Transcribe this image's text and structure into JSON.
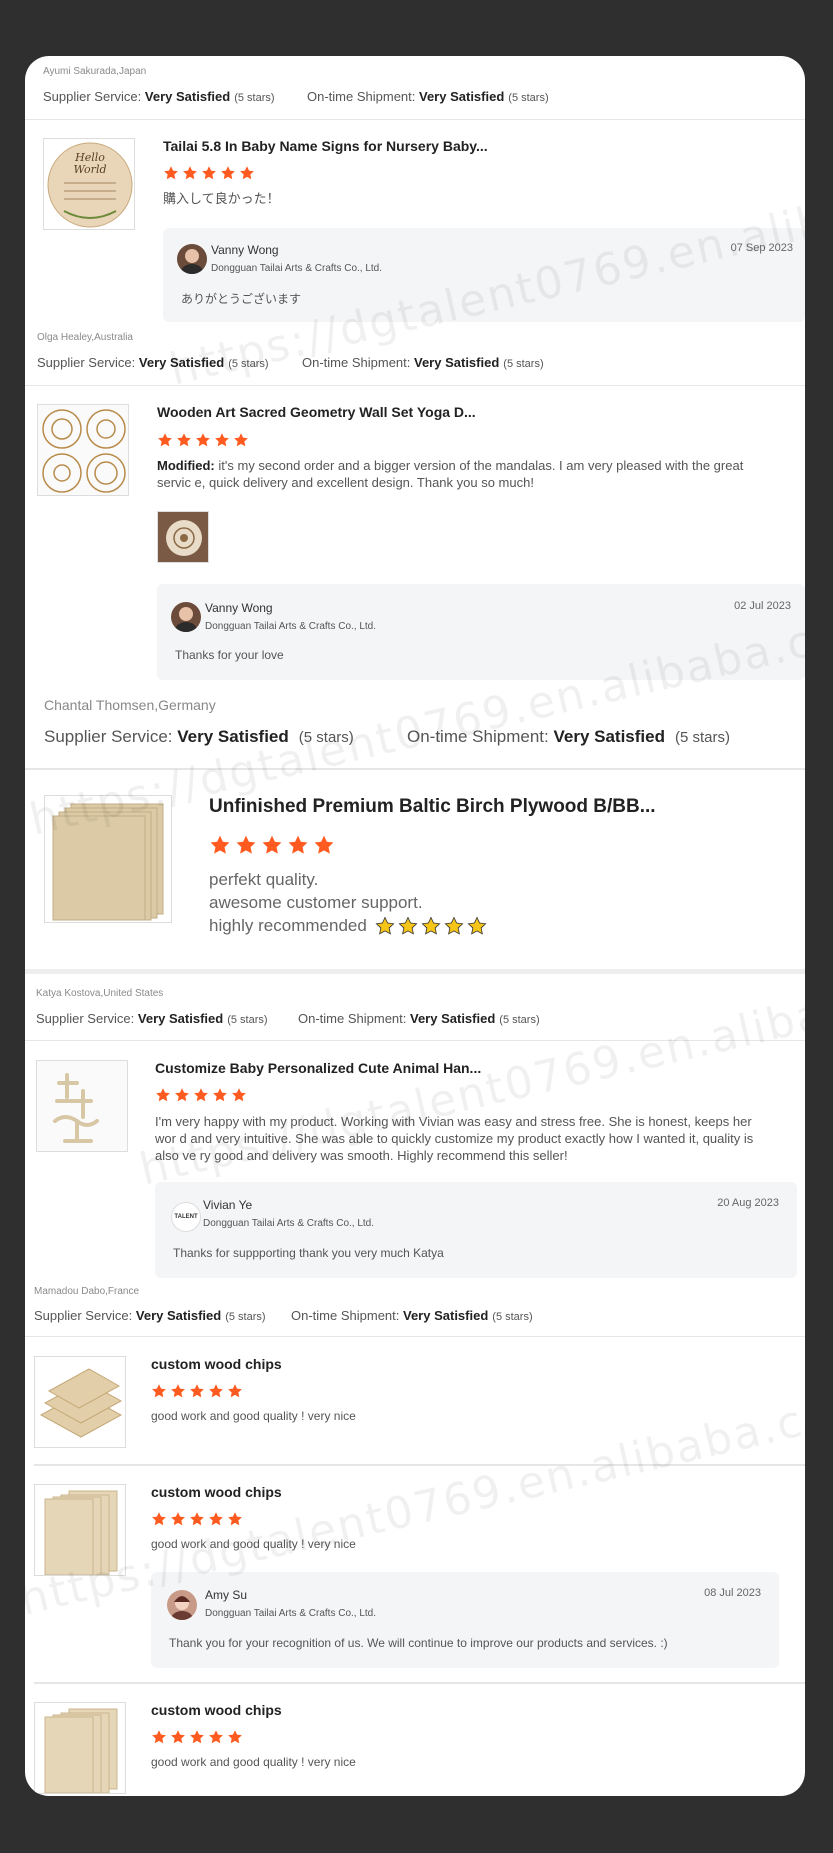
{
  "colors": {
    "star": "#ff5a1f",
    "reply_bg": "#f4f5f7",
    "gold_star": "#f5c518"
  },
  "watermark": "https://dgtalent0769.en.alibaba.com/",
  "reviews": [
    {
      "reviewer": "Ayumi Sakurada,Japan",
      "service_label": "Supplier Service:",
      "service_value": "Very Satisfied",
      "service_stars": "(5 stars)",
      "shipment_label": "On-time Shipment:",
      "shipment_value": "Very Satisfied",
      "shipment_stars": "(5 stars)",
      "product": "Tailai 5.8 In Baby Name Signs for Nursery Baby...",
      "text": "購入して良かった！",
      "reply": {
        "name": "Vanny Wong",
        "company": "Dongguan Tailai Arts & Crafts Co., Ltd.",
        "date": "07 Sep 2023",
        "text": "ありがとうございます"
      }
    },
    {
      "reviewer": "Olga Healey,Australia",
      "service_label": "Supplier Service:",
      "service_value": "Very Satisfied",
      "service_stars": "(5 stars)",
      "shipment_label": "On-time Shipment:",
      "shipment_value": "Very Satisfied",
      "shipment_stars": "(5 stars)",
      "product": "Wooden Art Sacred Geometry Wall Set Yoga D...",
      "text_prefix": "Modified:",
      "text": "it's my second order and a bigger version of the mandalas. I am very pleased with the great servic e, quick delivery and excellent design. Thank you so much!",
      "reply": {
        "name": "Vanny Wong",
        "company": "Dongguan Tailai Arts & Crafts Co., Ltd.",
        "date": "02 Jul 2023",
        "text": "Thanks for your love"
      }
    },
    {
      "reviewer": "Chantal Thomsen,Germany",
      "service_label": "Supplier Service:",
      "service_value": "Very Satisfied",
      "service_stars": "(5 stars)",
      "shipment_label": "On-time Shipment:",
      "shipment_value": "Very Satisfied",
      "shipment_stars": "(5 stars)",
      "product": "Unfinished Premium Baltic Birch Plywood B/BB...",
      "lines": [
        "perfekt quality.",
        "awesome customer support.",
        "highly recommended"
      ]
    },
    {
      "reviewer": "Katya Kostova,United States",
      "service_label": "Supplier Service:",
      "service_value": "Very Satisfied",
      "service_stars": "(5 stars)",
      "shipment_label": "On-time Shipment:",
      "shipment_value": "Very Satisfied",
      "shipment_stars": "(5 stars)",
      "product": "Customize Baby Personalized Cute Animal Han...",
      "text": "I'm very happy with my product. Working with Vivian was easy and stress free. She is honest, keeps her wor d and very intuitive. She was able to quickly customize my product exactly how I wanted it, quality is also ve ry good and delivery was smooth. Highly recommend this seller!",
      "reply": {
        "name": "Vivian Ye",
        "company": "Dongguan Tailai Arts & Crafts Co., Ltd.",
        "date": "20 Aug 2023",
        "text": "Thanks for suppporting  thank you very much  Katya",
        "avatar_text": "TALENT"
      }
    },
    {
      "reviewer": "Mamadou Dabo,France",
      "service_label": "Supplier Service:",
      "service_value": "Very Satisfied",
      "service_stars": "(5 stars)",
      "shipment_label": "On-time Shipment:",
      "shipment_value": "Very Satisfied",
      "shipment_stars": "(5 stars)",
      "items": [
        {
          "product": "custom wood chips",
          "text": "good work and good quality ! very nice"
        },
        {
          "product": "custom wood chips",
          "text": "good work and good quality ! very nice",
          "reply": {
            "name": "Amy Su",
            "company": "Dongguan Tailai Arts & Crafts Co., Ltd.",
            "date": "08 Jul 2023",
            "text": "Thank you for your recognition of us. We will continue to improve our products and services. :)"
          }
        },
        {
          "product": "custom wood chips",
          "text": "good work and good quality ! very nice"
        }
      ]
    }
  ]
}
